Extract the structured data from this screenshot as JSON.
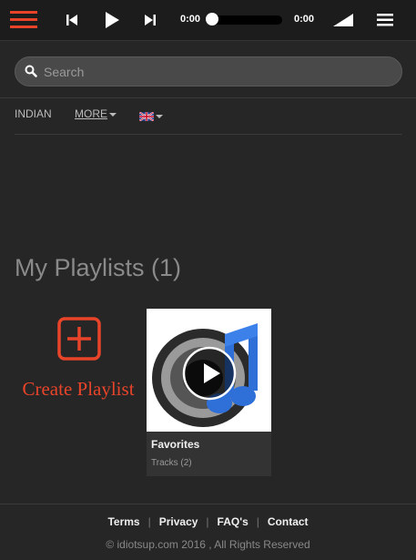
{
  "player": {
    "current_time": "0:00",
    "total_time": "0:00",
    "progress": 0
  },
  "search": {
    "placeholder": "Search",
    "value": ""
  },
  "nav": {
    "items": [
      {
        "label": "INDIAN"
      },
      {
        "label": "MORE"
      }
    ],
    "language_icon": "uk-flag-icon"
  },
  "main": {
    "section_title": "My Playlists (1)",
    "create_playlist_label": "Create Playlist",
    "playlists": [
      {
        "name": "Favorites",
        "tracks_label": "Tracks (2)"
      }
    ]
  },
  "footer": {
    "links": [
      "Terms",
      "Privacy",
      "FAQ's",
      "Contact"
    ],
    "copyright": "© idiotsup.com 2016 , All Rights Reserved"
  },
  "colors": {
    "accent": "#e8442a",
    "background": "#262626",
    "topbar": "#1c1c1c"
  }
}
